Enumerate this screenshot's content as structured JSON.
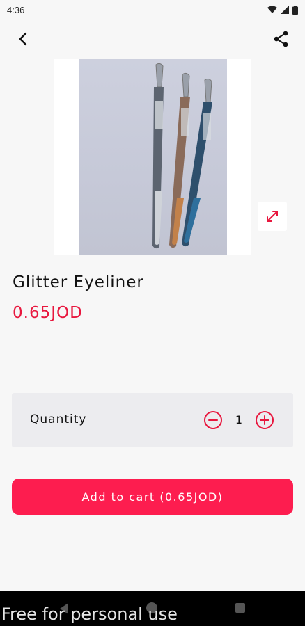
{
  "status_bar": {
    "time": "4:36",
    "icons": [
      "wifi-icon",
      "signal-icon",
      "battery-icon"
    ]
  },
  "app_bar": {
    "back_icon": "chevron-left-icon",
    "share_icon": "share-icon"
  },
  "product": {
    "title": "Glitter Eyeliner",
    "price": "0.65JOD",
    "pencil_colors": [
      "#7d8798",
      "#c2814a",
      "#2e6f9c"
    ]
  },
  "quantity": {
    "label": "Quantity",
    "value": "1",
    "decrement_icon": "minus-circle-icon",
    "increment_icon": "plus-circle-icon"
  },
  "cart": {
    "label": "Add to cart (0.65JOD)"
  },
  "watermark": {
    "text": "Free for personal use"
  },
  "colors": {
    "accent": "#fd1d4f",
    "price": "#e8173e",
    "background": "#f7f7f7",
    "card": "#ececef"
  }
}
